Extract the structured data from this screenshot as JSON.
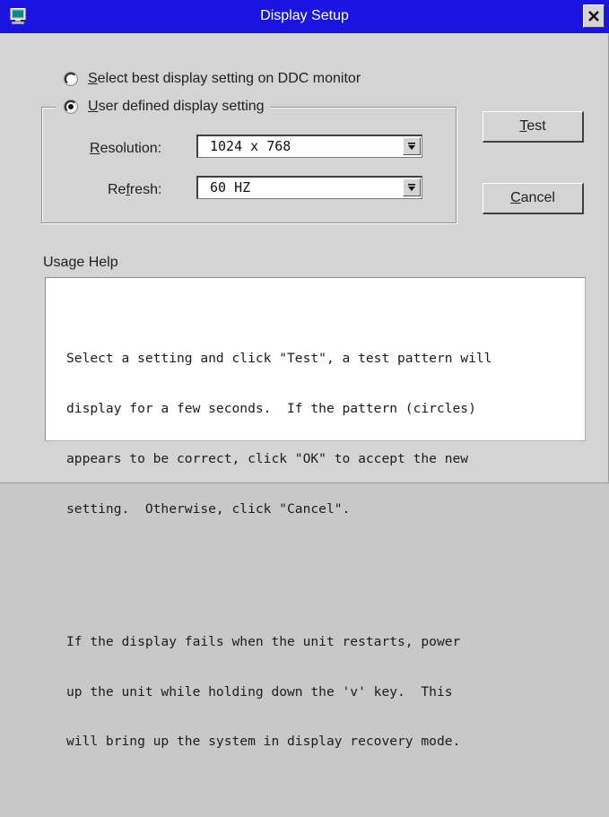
{
  "window": {
    "title": "Display Setup",
    "icons": {
      "app": "monitor-icon",
      "close": "close-icon"
    }
  },
  "options": {
    "ddc": {
      "mnemonic": "S",
      "rest": "elect best display setting on DDC monitor",
      "checked": false
    },
    "user_defined": {
      "mnemonic": "U",
      "rest": "ser defined display setting",
      "checked": true
    }
  },
  "resolution": {
    "label_mnemonic": "R",
    "label_rest": "esolution:",
    "value": "1024 x 768"
  },
  "refresh": {
    "label_pre": "Re",
    "label_mnemonic": "f",
    "label_rest": "resh:",
    "value": "60 HZ"
  },
  "buttons": {
    "test": {
      "mnemonic": "T",
      "rest": "est"
    },
    "cancel": {
      "mnemonic": "C",
      "rest": "ancel"
    }
  },
  "usage_help": {
    "label": "Usage Help",
    "paragraph1": [
      "Select a setting and click \"Test\", a test pattern will",
      "display for a few seconds.  If the pattern (circles)",
      "appears to be correct, click \"OK\" to accept the new",
      "setting.  Otherwise, click \"Cancel\"."
    ],
    "paragraph2": [
      "If the display fails when the unit restarts, power",
      "up the unit while holding down the 'v' key.  This",
      "will bring up the system in display recovery mode."
    ]
  },
  "colors": {
    "titlebar": "#1a14e0",
    "dialog_bg": "#d4d4d4",
    "help_bg": "#ffffff"
  }
}
